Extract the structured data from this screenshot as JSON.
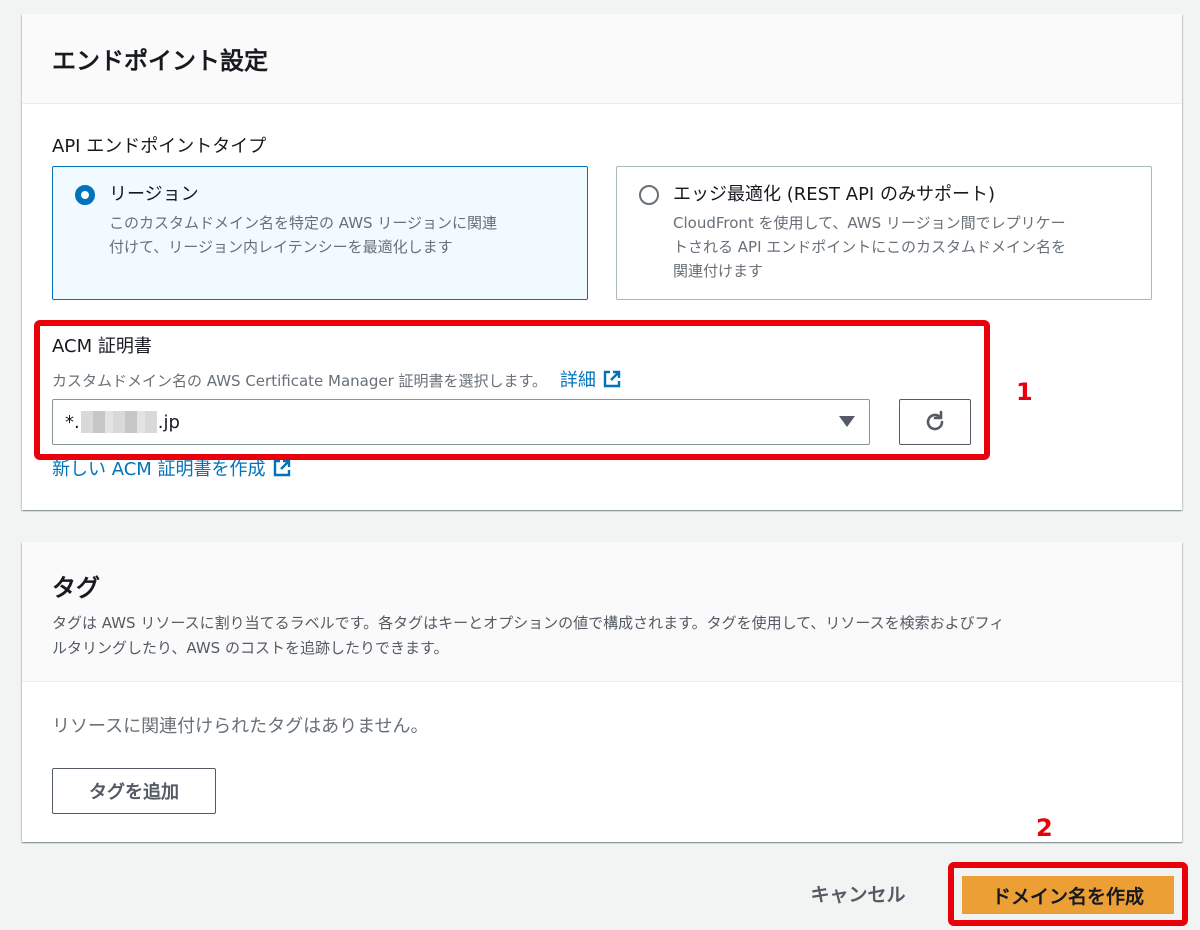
{
  "colors": {
    "accent": "#0073bb",
    "primary_button": "#ec9f35",
    "annotation_red": "#e8000b"
  },
  "endpoint_settings": {
    "title": "エンドポイント設定",
    "endpoint_type_label": "API エンドポイントタイプ",
    "options": [
      {
        "title": "リージョン",
        "desc_line1": "このカスタムドメイン名を特定の AWS リージョンに関連",
        "desc_line2": "付けて、リージョン内レイテンシーを最適化します",
        "selected": true
      },
      {
        "title": "エッジ最適化 (REST API のみサポート)",
        "desc_line1": "CloudFront を使用して、AWS リージョン間でレプリケー",
        "desc_line2": "トされる API エンドポイントにこのカスタムドメイン名を",
        "desc_line3": "関連付けます",
        "selected": false
      }
    ],
    "acm_label": "ACM 証明書",
    "acm_desc": "カスタムドメイン名の AWS Certificate Manager 証明書を選択します。",
    "acm_detail_link": "詳細",
    "acm_value_prefix": "*.",
    "acm_value_suffix": ".jp",
    "new_cert_link": "新しい ACM 証明書を作成"
  },
  "annotations": {
    "step1": "1",
    "step2": "2"
  },
  "tags": {
    "title": "タグ",
    "desc_line1": "タグは AWS リソースに割り当てるラベルです。各タグはキーとオプションの値で構成されます。タグを使用して、リソースを検索およびフィ",
    "desc_line2": "ルタリングしたり、AWS のコストを追跡したりできます。",
    "empty_message": "リソースに関連付けられたタグはありません。",
    "add_button": "タグを追加"
  },
  "footer": {
    "cancel_label": "キャンセル",
    "create_label": "ドメイン名を作成"
  },
  "icons": [
    "external-link-icon",
    "refresh-icon",
    "caret-down-icon"
  ]
}
